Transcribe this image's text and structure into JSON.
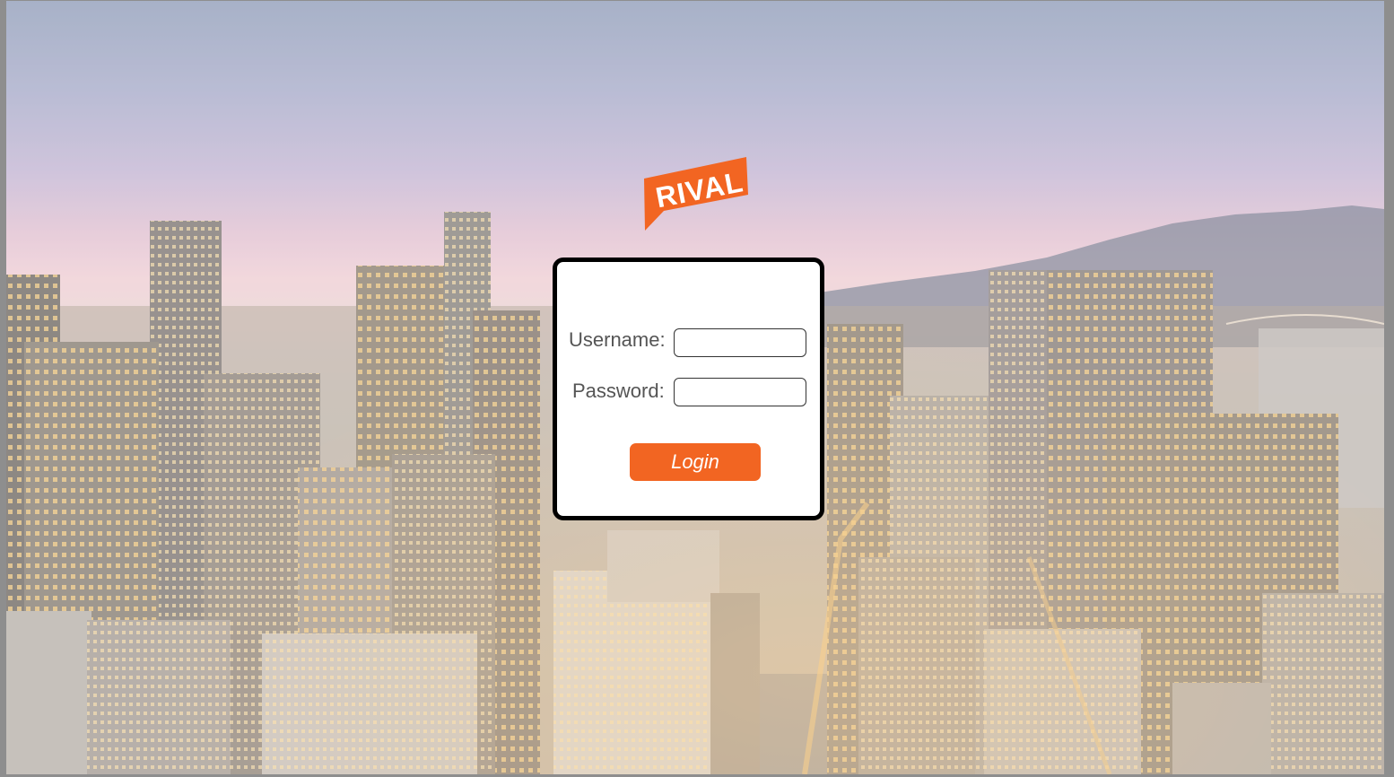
{
  "brand": {
    "logo_text": "RIVAL",
    "color": "#f26522"
  },
  "login": {
    "username_label": "Username:",
    "username_value": "",
    "password_label": "Password:",
    "password_value": "",
    "button_label": "Login",
    "button_color": "#f26522"
  },
  "background": {
    "description_icon": "city-skyline-photo"
  }
}
